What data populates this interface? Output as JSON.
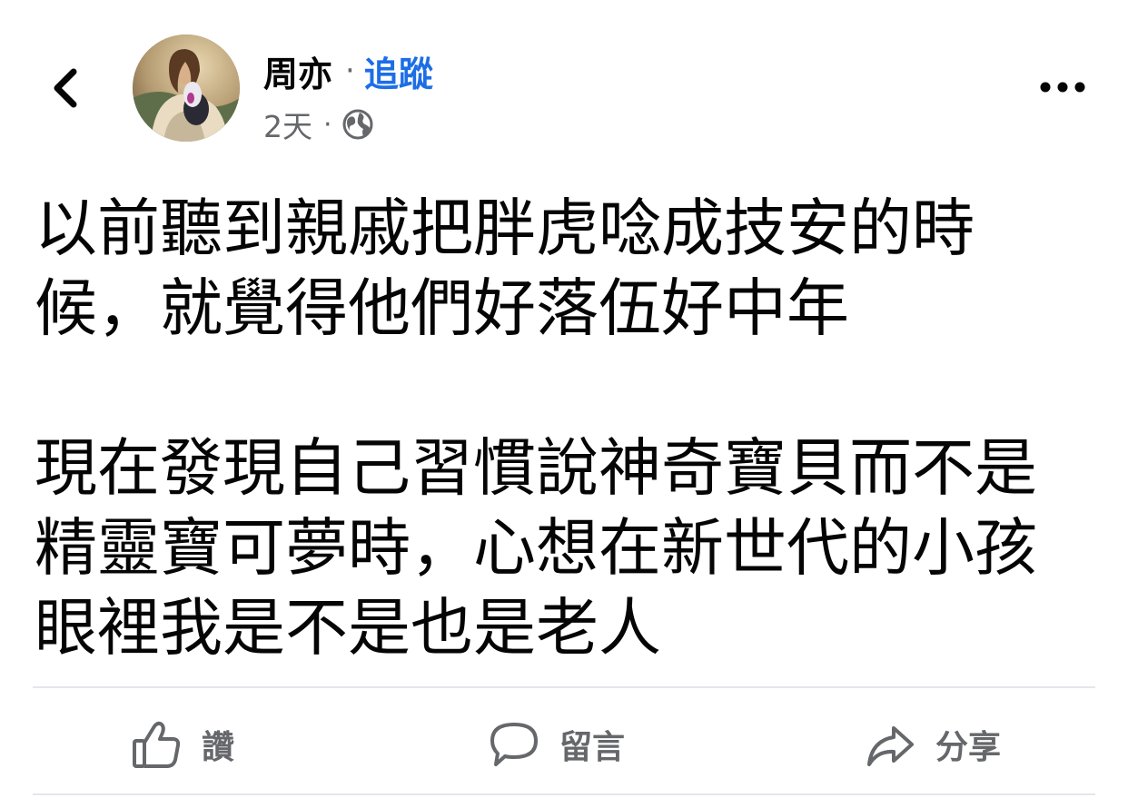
{
  "header": {
    "author_name": "周亦",
    "separator": "·",
    "follow_label": "追蹤",
    "post_time": "2天",
    "meta_separator": "·",
    "privacy_icon": "globe-icon",
    "back_icon": "chevron-left-icon",
    "more_icon": "more-dots-icon",
    "avatar": "avatar-photo"
  },
  "post": {
    "text": "以前聽到親戚把胖虎唸成技安的時\n候，就覺得他們好落伍好中年\n\n現在發現自己習慣說神奇寶貝而不是\n精靈寶可夢時，心想在新世代的小孩\n眼裡我是不是也是老人"
  },
  "actions": {
    "like_label": "讚",
    "comment_label": "留言",
    "share_label": "分享",
    "like_icon": "thumbs-up-icon",
    "comment_icon": "comment-bubble-icon",
    "share_icon": "share-arrow-icon"
  },
  "colors": {
    "link_blue": "#1c6ee6",
    "secondary_text": "#65676b",
    "primary_text": "#050505",
    "divider": "#e4e6eb"
  }
}
